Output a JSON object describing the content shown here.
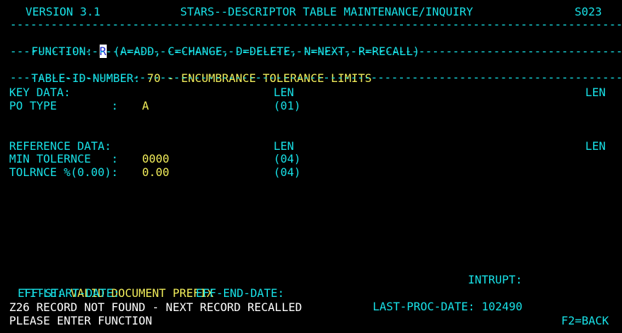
{
  "header": {
    "version": "VERSION 3.1",
    "title": "STARS--DESCRIPTOR TABLE MAINTENANCE/INQUIRY",
    "screen_id": "S023"
  },
  "separator": "------------------------------------------------------------------------------------------",
  "function_line": {
    "label": "FUNCTION: ",
    "value": "R",
    "options": " (A=ADD, C=CHANGE, D=DELETE, N=NEXT, R=RECALL)"
  },
  "table_line": {
    "label": "TABLE-ID-NUMBER: ",
    "value": "70 - ENCUMBRANCE TOLERANCE LIMITS"
  },
  "key_data": {
    "heading": "KEY DATA:",
    "len_header": "LEN",
    "len_header_right": "LEN",
    "rows": [
      {
        "label": "PO TYPE        : ",
        "value": "A",
        "len": "(01)"
      }
    ]
  },
  "reference_data": {
    "heading": "REFERENCE DATA:",
    "len_header": "LEN",
    "len_header_right": "LEN",
    "rows": [
      {
        "label": "MIN TOLERNCE   : ",
        "value": "0000",
        "len": "(04)"
      },
      {
        "label": "TOLRNCE %(0.00): ",
        "value": "0.00",
        "len": "(04)"
      }
    ]
  },
  "footer": {
    "title_label": "TITLE: ",
    "title_value": "VALID DOCUMENT PREFIX",
    "intrupt_label": "INTRUPT:",
    "eff_start_label": "EFF-START-DATE:",
    "eff_end_label": "EFF-END-DATE:",
    "last_proc_label": "LAST-PROC-DATE: ",
    "last_proc_value": "102490",
    "message": "Z26 RECORD NOT FOUND - NEXT RECORD RECALLED",
    "prompt": "PLEASE ENTER FUNCTION",
    "f2_label": "F2=BACK"
  }
}
